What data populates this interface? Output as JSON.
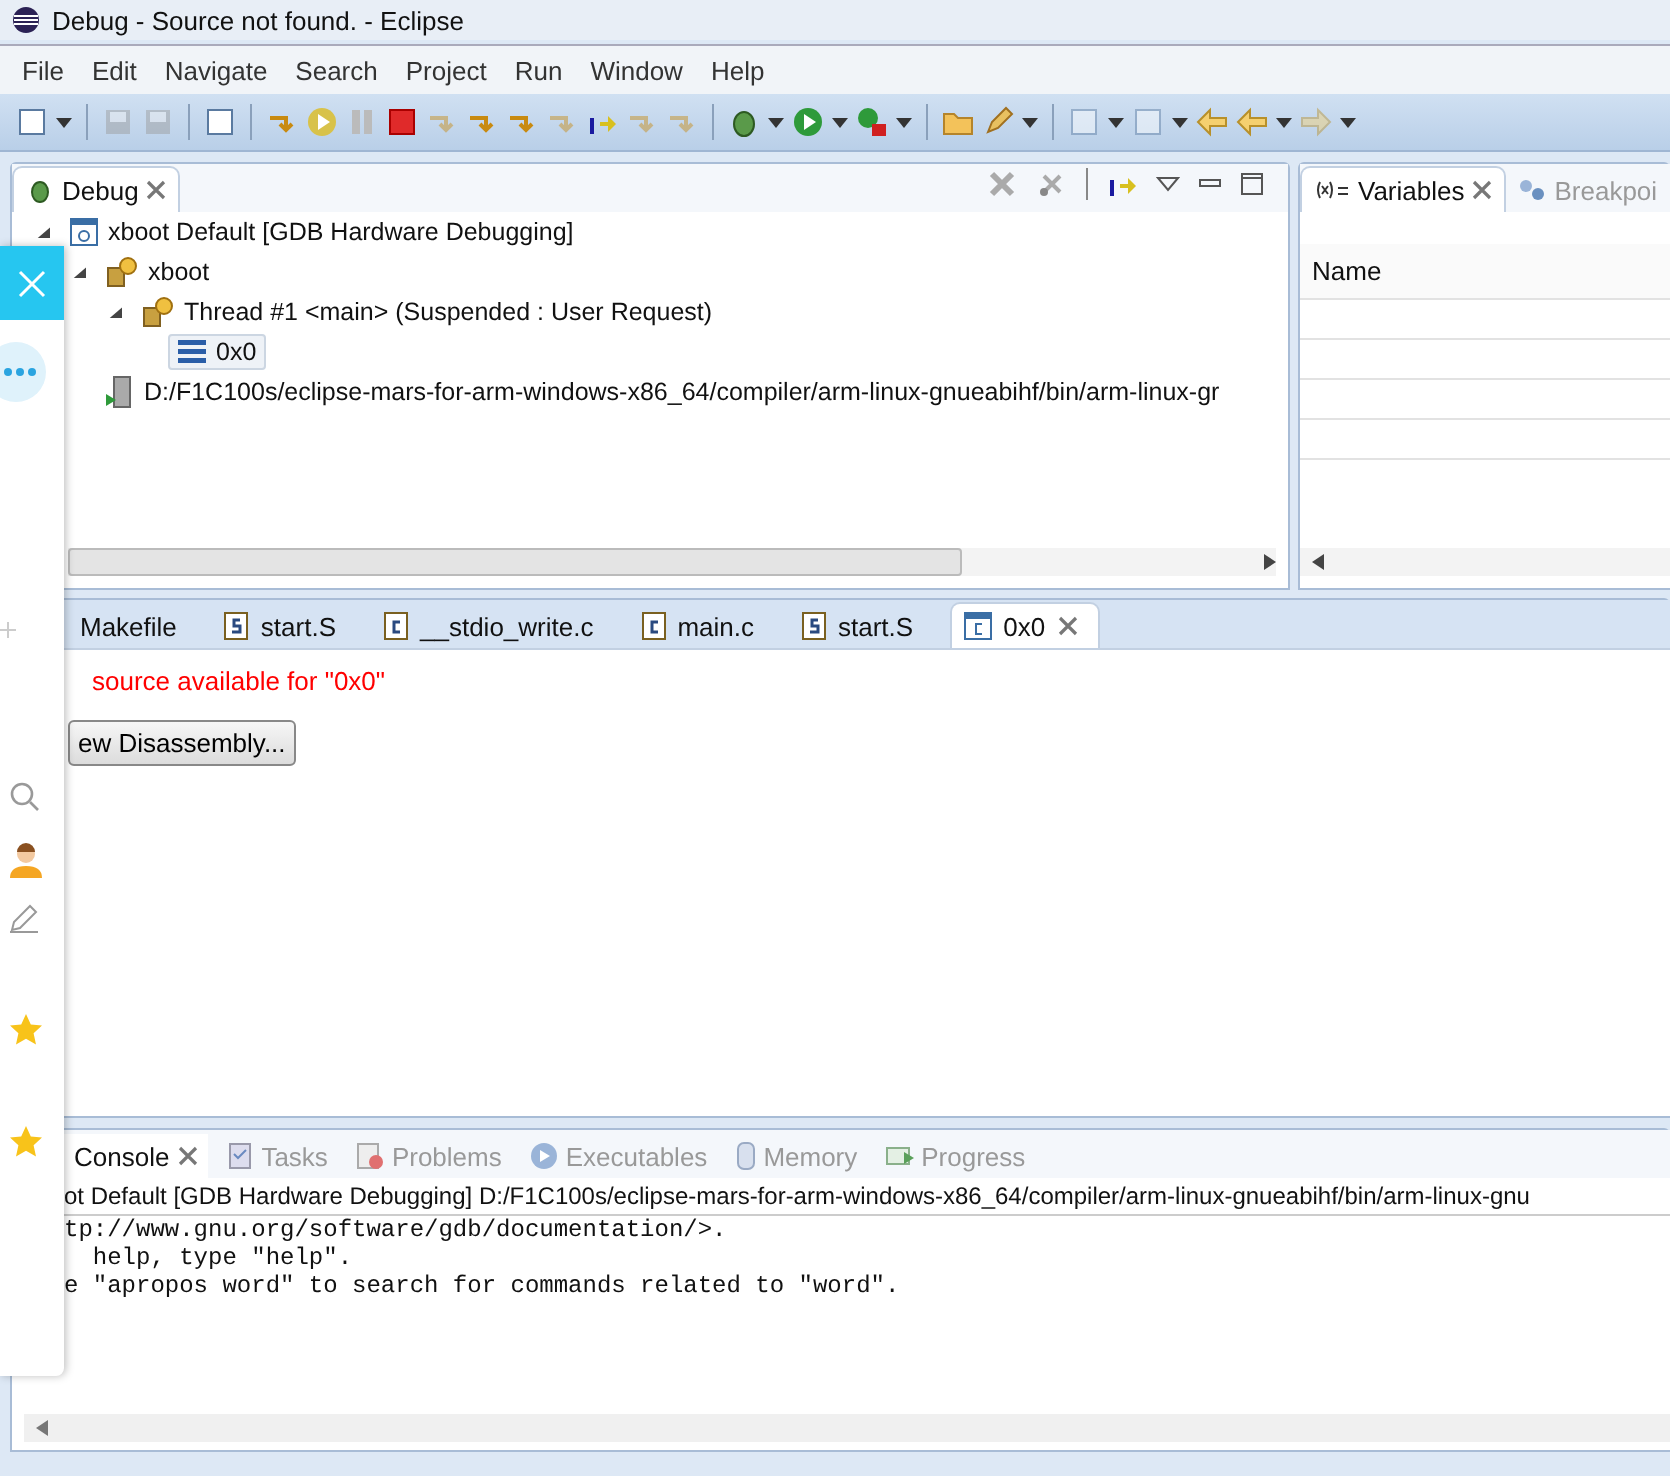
{
  "window": {
    "title": "Debug - Source not found. - Eclipse"
  },
  "menu": [
    "File",
    "Edit",
    "Navigate",
    "Search",
    "Project",
    "Run",
    "Window",
    "Help"
  ],
  "debug_view": {
    "tab": {
      "label": "Debug",
      "selected": true
    },
    "tree": [
      {
        "label": "xboot Default [GDB Hardware Debugging]",
        "kind": "launch",
        "expanded": true,
        "selected": false,
        "children": [
          {
            "label": "xboot",
            "kind": "process",
            "expanded": true,
            "selected": false,
            "children": [
              {
                "label": "Thread #1 <main> (Suspended : User Request)",
                "kind": "thread",
                "expanded": true,
                "selected": false,
                "children": [
                  {
                    "label": "0x0",
                    "kind": "frame",
                    "selected": true
                  }
                ]
              }
            ]
          },
          {
            "label": "D:/F1C100s/eclipse-mars-for-arm-windows-x86_64/compiler/arm-linux-gnueabihf/bin/arm-linux-gr",
            "kind": "binary",
            "selected": false
          }
        ]
      }
    ]
  },
  "variables_view": {
    "tabs": [
      {
        "label": "Variables",
        "kind": "variables",
        "selected": true
      },
      {
        "label": "Breakpoi",
        "kind": "breakpoints",
        "selected": false
      }
    ],
    "columns": [
      "Name"
    ]
  },
  "editor": {
    "tabs": [
      {
        "label": "Makefile",
        "kind": "makefile",
        "selected": false
      },
      {
        "label": "start.S",
        "kind": "asm",
        "selected": false
      },
      {
        "label": "__stdio_write.c",
        "kind": "c",
        "selected": false
      },
      {
        "label": "main.c",
        "kind": "c",
        "selected": false
      },
      {
        "label": "start.S",
        "kind": "asm",
        "selected": false
      },
      {
        "label": "0x0",
        "kind": "disasm",
        "selected": true
      }
    ],
    "message": "source available for \"0x0\"",
    "button": "ew Disassembly..."
  },
  "console_view": {
    "tabs": [
      {
        "label": "Console",
        "kind": "console",
        "selected": true
      },
      {
        "label": "Tasks",
        "kind": "tasks",
        "selected": false
      },
      {
        "label": "Problems",
        "kind": "problems",
        "selected": false
      },
      {
        "label": "Executables",
        "kind": "executables",
        "selected": false
      },
      {
        "label": "Memory",
        "kind": "memory",
        "selected": false
      },
      {
        "label": "Progress",
        "kind": "progress",
        "selected": false
      }
    ],
    "header": "ot Default [GDB Hardware Debugging] D:/F1C100s/eclipse-mars-for-arm-windows-x86_64/compiler/arm-linux-gnueabihf/bin/arm-linux-gnu",
    "lines": [
      "tp://www.gnu.org/software/gdb/documentation/>.",
      "  help, type \"help\".",
      "e \"apropos word\" to search for commands related to \"word\"."
    ]
  }
}
